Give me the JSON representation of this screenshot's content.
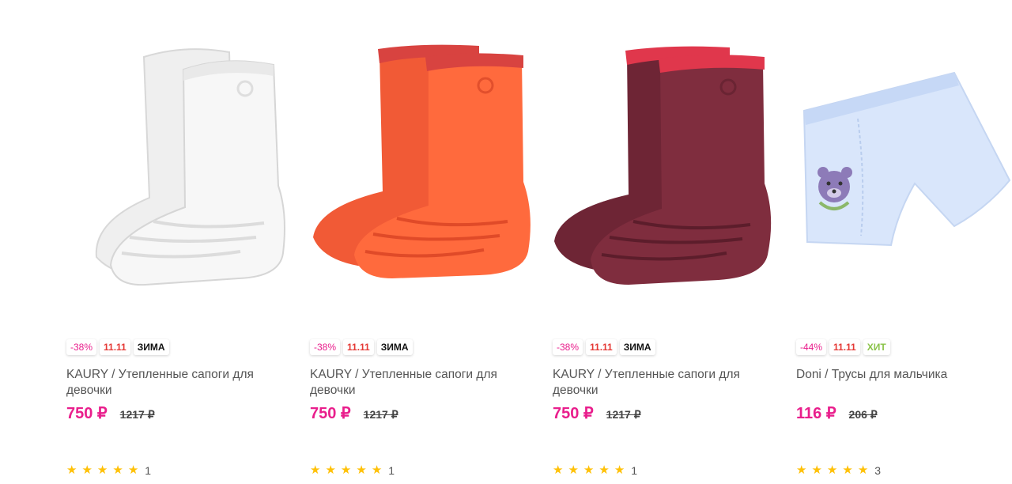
{
  "colors": {
    "accent_pink": "#e91e8c",
    "promo_red": "#e53935",
    "hit_green": "#8bc34a",
    "star_yellow": "#ffc107"
  },
  "products": [
    {
      "image": "white-rubber-boots",
      "badges": {
        "discount": "-38%",
        "promo": "11.11",
        "tag": "ЗИМА"
      },
      "title": "KAURY / Утепленные сапоги для девочки",
      "price": "750 ₽",
      "old_price": "1217 ₽",
      "rating": 5,
      "reviews": "1"
    },
    {
      "image": "orange-rubber-boots",
      "badges": {
        "discount": "-38%",
        "promo": "11.11",
        "tag": "ЗИМА"
      },
      "title": "KAURY / Утепленные сапоги для девочки",
      "price": "750 ₽",
      "old_price": "1217 ₽",
      "rating": 5,
      "reviews": "1"
    },
    {
      "image": "burgundy-rubber-boots",
      "badges": {
        "discount": "-38%",
        "promo": "11.11",
        "tag": "ЗИМА"
      },
      "title": "KAURY / Утепленные сапоги для девочки",
      "price": "750 ₽",
      "old_price": "1217 ₽",
      "rating": 5,
      "reviews": "1"
    },
    {
      "image": "boys-briefs-bear",
      "badges": {
        "discount": "-44%",
        "promo": "11.11",
        "tag": "ХИТ"
      },
      "title": "Doni / Трусы для мальчика",
      "price": "116 ₽",
      "old_price": "206 ₽",
      "rating": 5,
      "reviews": "3"
    }
  ]
}
